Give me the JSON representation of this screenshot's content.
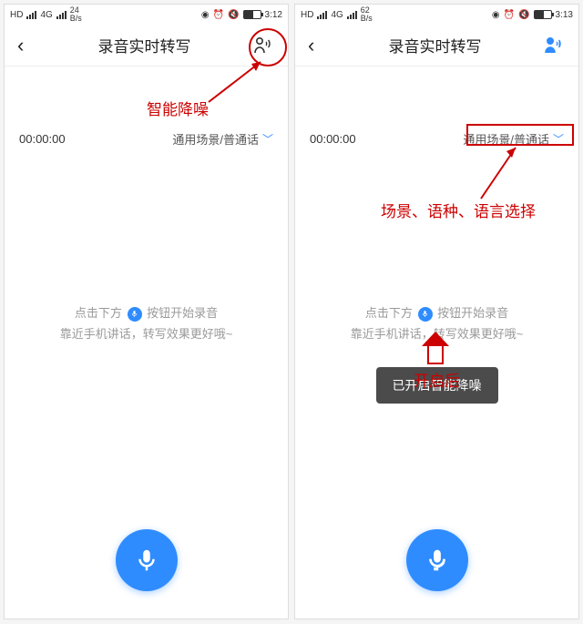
{
  "left": {
    "status": {
      "speed": "24",
      "speed_unit": "B/s",
      "time": "3:12",
      "hd": "HD",
      "net": "4G",
      "battery_pct": 60
    },
    "nav": {
      "title": "录音实时转写"
    },
    "timer": "00:00:00",
    "scene": "通用场景/普通话",
    "hint1_a": "点击下方",
    "hint1_b": "按钮开始录音",
    "hint2": "靠近手机讲话，转写效果更好哦~"
  },
  "right": {
    "status": {
      "speed": "62",
      "speed_unit": "B/s",
      "time": "3:13",
      "hd": "HD",
      "net": "4G",
      "battery_pct": 60
    },
    "nav": {
      "title": "录音实时转写"
    },
    "timer": "00:00:00",
    "scene": "通用场景/普通话",
    "hint1_a": "点击下方",
    "hint1_b": "按钮开始录音",
    "hint2": "靠近手机讲话，转写效果更好哦~",
    "toast": "已开启智能降噪"
  },
  "annotations": {
    "noise_reduction": "智能降噪",
    "scene_select": "场景、语种、语言选择",
    "after_enable": "开启后"
  }
}
